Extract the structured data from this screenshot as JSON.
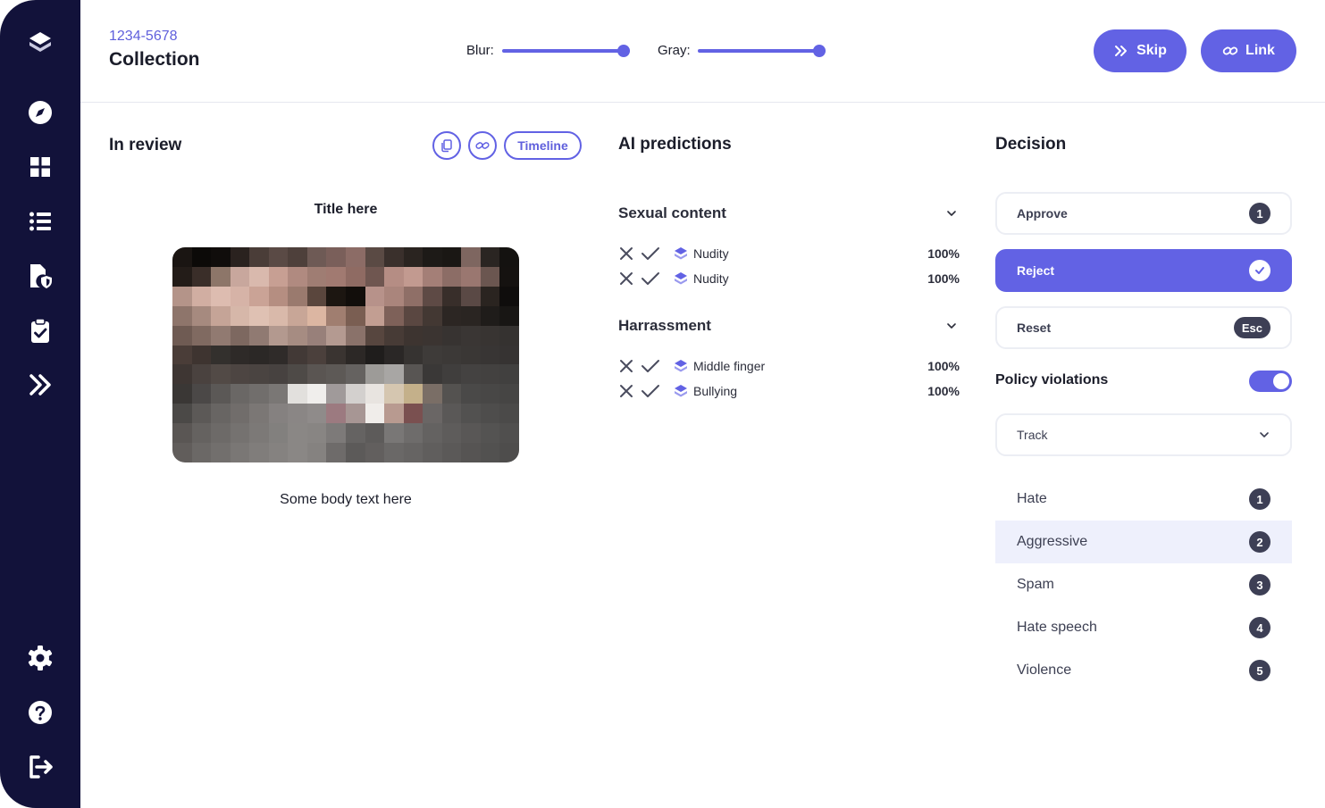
{
  "header": {
    "id": "1234-5678",
    "title": "Collection",
    "blur_label": "Blur:",
    "blur_value": 1.0,
    "gray_label": "Gray:",
    "gray_value": 1.0,
    "skip_label": "Skip",
    "link_label": "Link"
  },
  "review": {
    "title": "In review",
    "timeline_label": "Timeline",
    "media_title": "Title here",
    "media_body": "Some body text here"
  },
  "predictions": {
    "title": "AI predictions",
    "groups": [
      {
        "name": "Sexual content",
        "items": [
          {
            "label": "Nudity",
            "score": "100%"
          },
          {
            "label": "Nudity",
            "score": "100%"
          }
        ]
      },
      {
        "name": "Harrassment",
        "items": [
          {
            "label": "Middle finger",
            "score": "100%"
          },
          {
            "label": "Bullying",
            "score": "100%"
          }
        ]
      }
    ]
  },
  "decision": {
    "title": "Decision",
    "approve": {
      "label": "Approve",
      "key": "1"
    },
    "reject": {
      "label": "Reject"
    },
    "reset": {
      "label": "Reset",
      "key": "Esc"
    },
    "policy_label": "Policy violations",
    "policy_enabled": true,
    "select_value": "Track",
    "violations": [
      {
        "label": "Hate",
        "key": "1"
      },
      {
        "label": "Aggressive",
        "key": "2"
      },
      {
        "label": "Spam",
        "key": "3"
      },
      {
        "label": "Hate speech",
        "key": "4"
      },
      {
        "label": "Violence",
        "key": "5"
      }
    ]
  },
  "sidebar": {
    "icons": [
      "logo-icon",
      "compass-icon",
      "grid-icon",
      "list-icon",
      "document-shield-icon",
      "clipboard-check-icon",
      "double-chevron-right-icon",
      "gear-icon",
      "help-icon",
      "logout-icon"
    ]
  },
  "colors": {
    "accent": "#6262e4",
    "sidebar": "#12123a",
    "badge": "#3d3f55",
    "highlight": "#eef0fc"
  }
}
